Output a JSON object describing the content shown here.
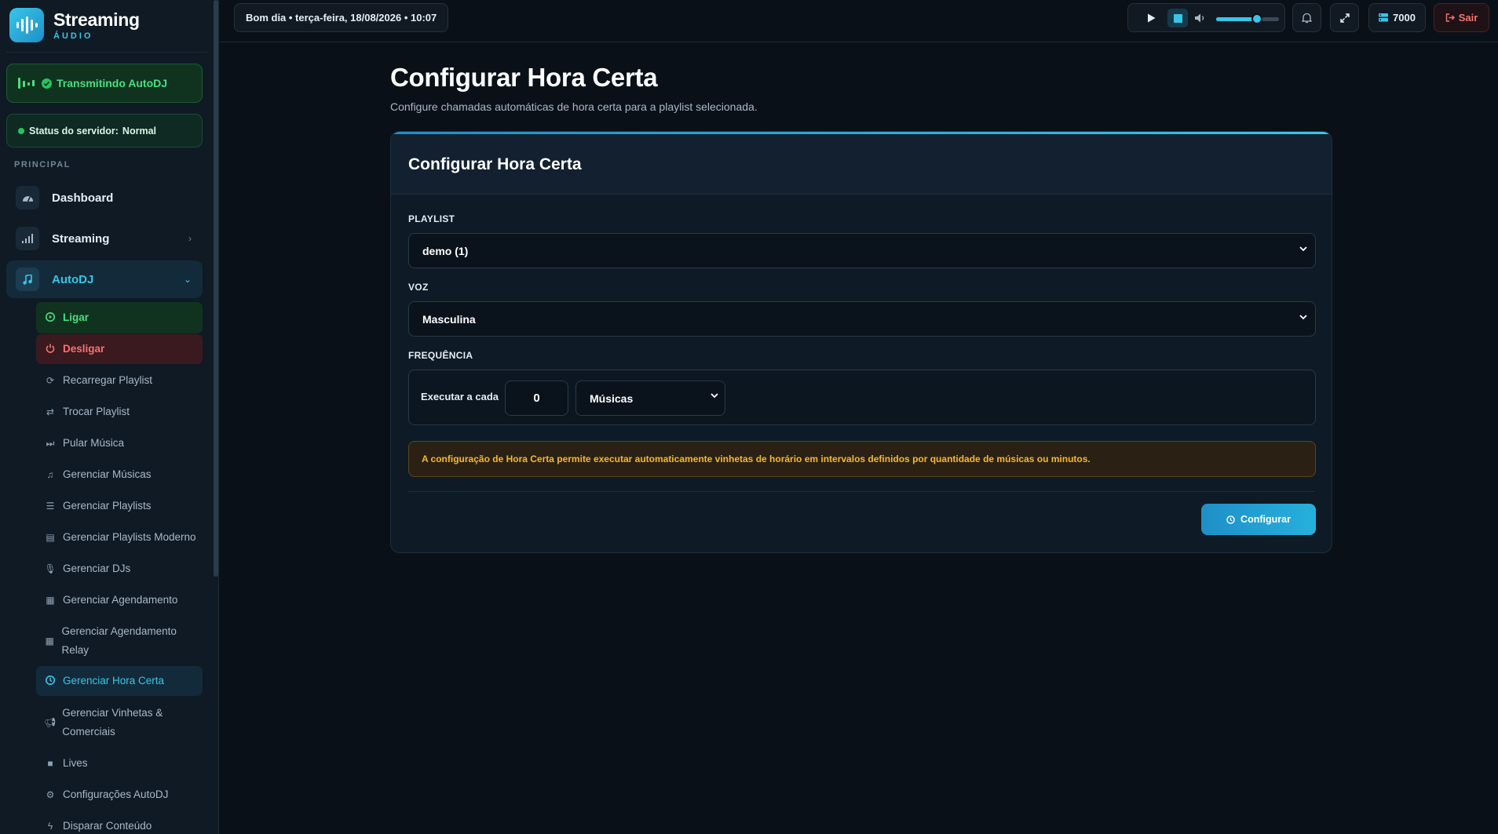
{
  "brand": {
    "name": "Streaming",
    "sub": "ÁUDIO"
  },
  "status": {
    "autodj": "Transmitindo AutoDJ",
    "server_label": "Status do servidor:",
    "server_value": "Normal"
  },
  "sidebar": {
    "section": "PRINCIPAL",
    "items": [
      {
        "label": "Dashboard",
        "icon": "dashboard-icon"
      },
      {
        "label": "Streaming",
        "icon": "signal-icon"
      },
      {
        "label": "AutoDJ",
        "icon": "music-note-icon"
      }
    ],
    "autodj_sub": [
      {
        "label": "Ligar",
        "icon": "play-circle-icon"
      },
      {
        "label": "Desligar",
        "icon": "power-icon"
      },
      {
        "label": "Recarregar Playlist",
        "icon": "refresh-icon"
      },
      {
        "label": "Trocar Playlist",
        "icon": "swap-icon"
      },
      {
        "label": "Pular Música",
        "icon": "skip-icon"
      },
      {
        "label": "Gerenciar Músicas",
        "icon": "music-icon"
      },
      {
        "label": "Gerenciar Playlists",
        "icon": "list-icon"
      },
      {
        "label": "Gerenciar Playlists Moderno",
        "icon": "table-icon"
      },
      {
        "label": "Gerenciar DJs",
        "icon": "microphone-icon"
      },
      {
        "label": "Gerenciar Agendamento",
        "icon": "calendar-icon"
      },
      {
        "label": "Gerenciar Agendamento Relay",
        "icon": "calendar-icon"
      },
      {
        "label": "Gerenciar Hora Certa",
        "icon": "clock-icon"
      },
      {
        "label": "Gerenciar Vinhetas & Comerciais",
        "icon": "megaphone-icon"
      },
      {
        "label": "Lives",
        "icon": "video-icon"
      },
      {
        "label": "Configurações AutoDJ",
        "icon": "gear-icon"
      },
      {
        "label": "Disparar Conteúdo",
        "icon": "bolt-icon"
      }
    ]
  },
  "topbar": {
    "greeting": "Bom dia • terça-feira, 18/08/2026 • 10:07",
    "volume": 0.65,
    "credits": "7000",
    "logout": "Sair"
  },
  "page": {
    "title": "Configurar Hora Certa",
    "subtitle": "Configure chamadas automáticas de hora certa para a playlist selecionada."
  },
  "card": {
    "title": "Configurar Hora Certa",
    "playlist_label": "PLAYLIST",
    "playlist_value": "demo (1)",
    "voice_label": "VOZ",
    "voice_value": "Masculina",
    "freq_label": "FREQUÊNCIA",
    "freq_prefix": "Executar a cada",
    "freq_value": "0",
    "freq_unit": "Músicas",
    "info": "A configuração de Hora Certa permite executar automaticamente vinhetas de horário em intervalos definidos por quantidade de músicas ou minutos.",
    "submit": "Configurar"
  }
}
